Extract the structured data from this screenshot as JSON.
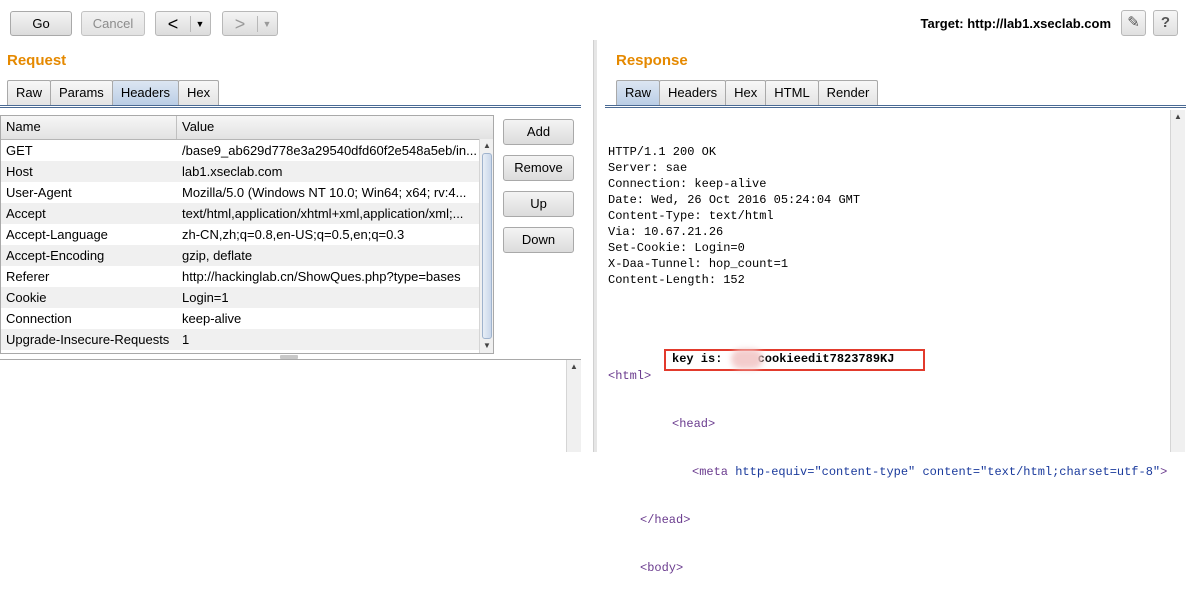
{
  "toolbar": {
    "go_label": "Go",
    "cancel_label": "Cancel",
    "back_arrow": "<",
    "forward_arrow": ">",
    "dropdown_glyph": "▼",
    "target_text": "Target: http://lab1.xseclab.com",
    "edit_icon_glyph": "✎",
    "help_icon_glyph": "?"
  },
  "request": {
    "title": "Request",
    "tabs": [
      "Raw",
      "Params",
      "Headers",
      "Hex"
    ],
    "active_tab": "Headers",
    "columns": {
      "name": "Name",
      "value": "Value"
    },
    "rows": [
      {
        "name": "GET",
        "value": "/base9_ab629d778e3a29540dfd60f2e548a5eb/in..."
      },
      {
        "name": "Host",
        "value": "lab1.xseclab.com"
      },
      {
        "name": "User-Agent",
        "value": "Mozilla/5.0 (Windows NT 10.0; Win64; x64; rv:4..."
      },
      {
        "name": "Accept",
        "value": "text/html,application/xhtml+xml,application/xml;..."
      },
      {
        "name": "Accept-Language",
        "value": "zh-CN,zh;q=0.8,en-US;q=0.5,en;q=0.3"
      },
      {
        "name": "Accept-Encoding",
        "value": "gzip, deflate"
      },
      {
        "name": "Referer",
        "value": "http://hackinglab.cn/ShowQues.php?type=bases"
      },
      {
        "name": "Cookie",
        "value": "Login=1"
      },
      {
        "name": "Connection",
        "value": "keep-alive"
      },
      {
        "name": "Upgrade-Insecure-Requests",
        "value": "1"
      }
    ],
    "buttons": {
      "add": "Add",
      "remove": "Remove",
      "up": "Up",
      "down": "Down"
    }
  },
  "response": {
    "title": "Response",
    "tabs": [
      "Raw",
      "Headers",
      "Hex",
      "HTML",
      "Render"
    ],
    "active_tab": "Raw",
    "header_lines": [
      "HTTP/1.1 200 OK",
      "Server: sae",
      "Connection: keep-alive",
      "Date: Wed, 26 Oct 2016 05:24:04 GMT",
      "Content-Type: text/html",
      "Via: 10.67.21.26",
      "Set-Cookie: Login=0",
      "X-Daa-Tunnel: hop_count=1",
      "Content-Length: 152"
    ],
    "html_open": "<html>",
    "head_open": "<head>",
    "meta_tag_open": "<meta",
    "meta_attr1_name": "http-equiv=",
    "meta_attr1_value": "\"content-type\"",
    "meta_attr2_name": "content=",
    "meta_attr2_value": "\"text/html;charset=utf-8\"",
    "meta_tag_close": ">",
    "head_close": "</head>",
    "body_open": "<body>",
    "key_label": "key is: ",
    "key_value": "cookieedit7823789KJ"
  },
  "colors": {
    "section_title": "#e58900",
    "highlight_border": "#e23a2c",
    "active_tab": "#b9cde5"
  }
}
